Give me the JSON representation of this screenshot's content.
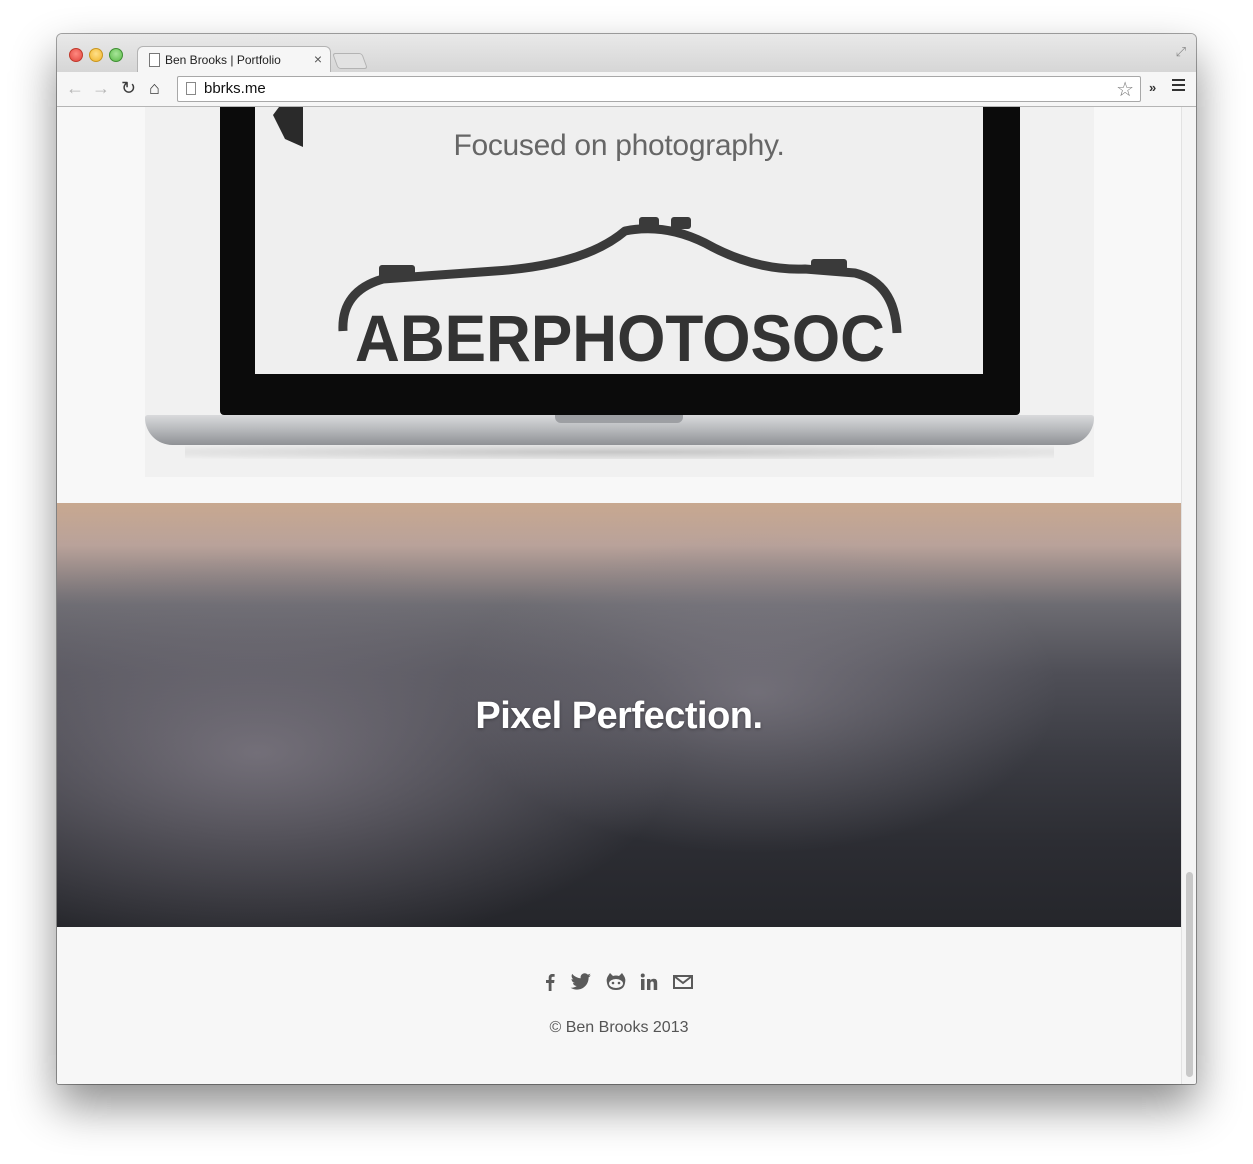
{
  "browser": {
    "tab_title": "Ben Brooks | Portfolio",
    "tab_close": "×",
    "url": "bbrks.me",
    "back_icon": "←",
    "forward_icon": "→",
    "reload_icon": "↻",
    "home_icon": "⌂",
    "star_icon": "☆",
    "extensions_icon": "»",
    "fullscreen_icon": "⤢"
  },
  "showcase": {
    "tagline": "Focused on photography.",
    "logo_text": "ABERPHOTOSOC"
  },
  "hero": {
    "title": "Pixel Perfection."
  },
  "footer": {
    "social_icons": [
      "facebook-icon",
      "twitter-icon",
      "github-icon",
      "linkedin-icon",
      "mail-icon"
    ],
    "copyright": "© Ben Brooks 2013"
  }
}
